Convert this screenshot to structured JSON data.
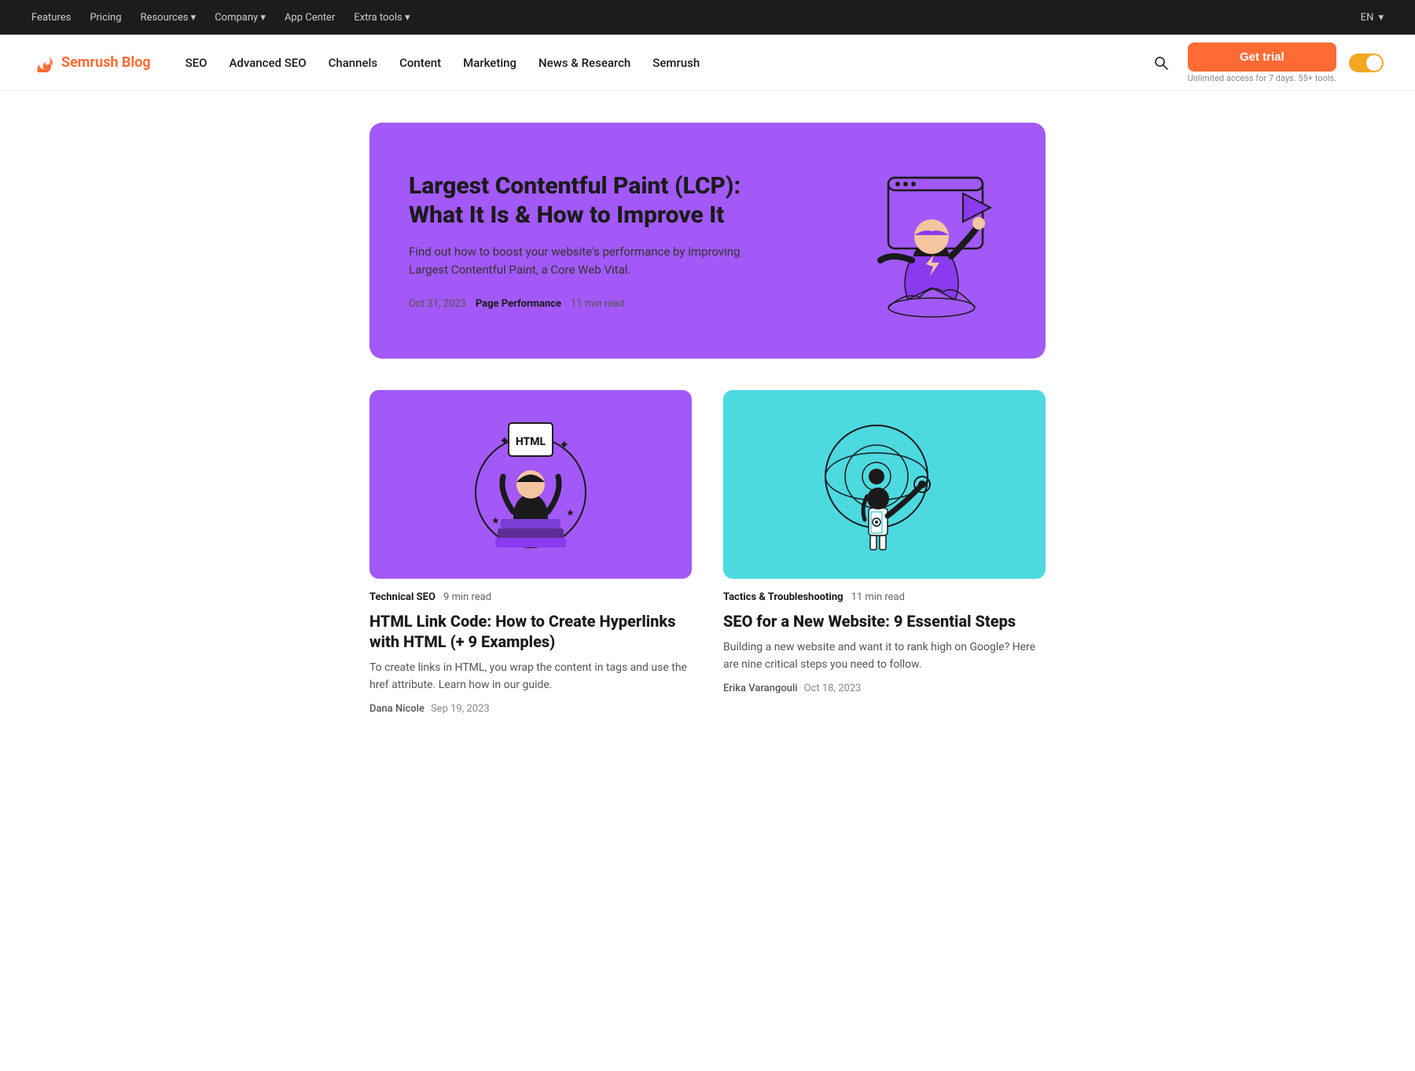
{
  "topnav": {
    "links": [
      {
        "label": "Features",
        "id": "features"
      },
      {
        "label": "Pricing",
        "id": "pricing"
      },
      {
        "label": "Resources",
        "id": "resources",
        "hasDropdown": true
      },
      {
        "label": "Company",
        "id": "company",
        "hasDropdown": true
      },
      {
        "label": "App Center",
        "id": "app-center"
      },
      {
        "label": "Extra tools",
        "id": "extra-tools",
        "hasDropdown": true
      }
    ],
    "lang": "EN",
    "lang_arrow": "▾"
  },
  "mainnav": {
    "logo_brand": "Semrush",
    "logo_blog": "Blog",
    "links": [
      {
        "label": "SEO",
        "id": "seo"
      },
      {
        "label": "Advanced SEO",
        "id": "advanced-seo"
      },
      {
        "label": "Channels",
        "id": "channels"
      },
      {
        "label": "Content",
        "id": "content"
      },
      {
        "label": "Marketing",
        "id": "marketing"
      },
      {
        "label": "News & Research",
        "id": "news-research"
      },
      {
        "label": "Semrush",
        "id": "semrush"
      }
    ],
    "cta_label": "Get trial",
    "cta_sub": "Unlimited access for 7 days. 55+ tools."
  },
  "featured": {
    "title": "Largest Contentful Paint (LCP): What It Is & How to Improve It",
    "desc": "Find out how to boost your website's performance by improving Largest Contentful Paint, a Core Web Vital.",
    "date": "Oct 31, 2023",
    "category": "Page Performance",
    "read_time": "11 min read"
  },
  "articles": [
    {
      "id": "html-link-code",
      "category": "Technical SEO",
      "read_time": "9 min read",
      "title": "HTML Link Code: How to Create Hyperlinks with HTML (+ 9 Examples)",
      "desc": "To create links in HTML, you wrap the content in tags and use the href attribute. Learn how in our guide.",
      "author": "Dana Nicole",
      "date": "Sep 19, 2023",
      "image_style": "purple"
    },
    {
      "id": "seo-new-website",
      "category": "Tactics & Troubleshooting",
      "read_time": "11 min read",
      "title": "SEO for a New Website: 9 Essential Steps",
      "desc": "Building a new website and want it to rank high on Google? Here are nine critical steps you need to follow.",
      "author": "Erika Varangouli",
      "date": "Oct 18, 2023",
      "image_style": "cyan"
    }
  ]
}
